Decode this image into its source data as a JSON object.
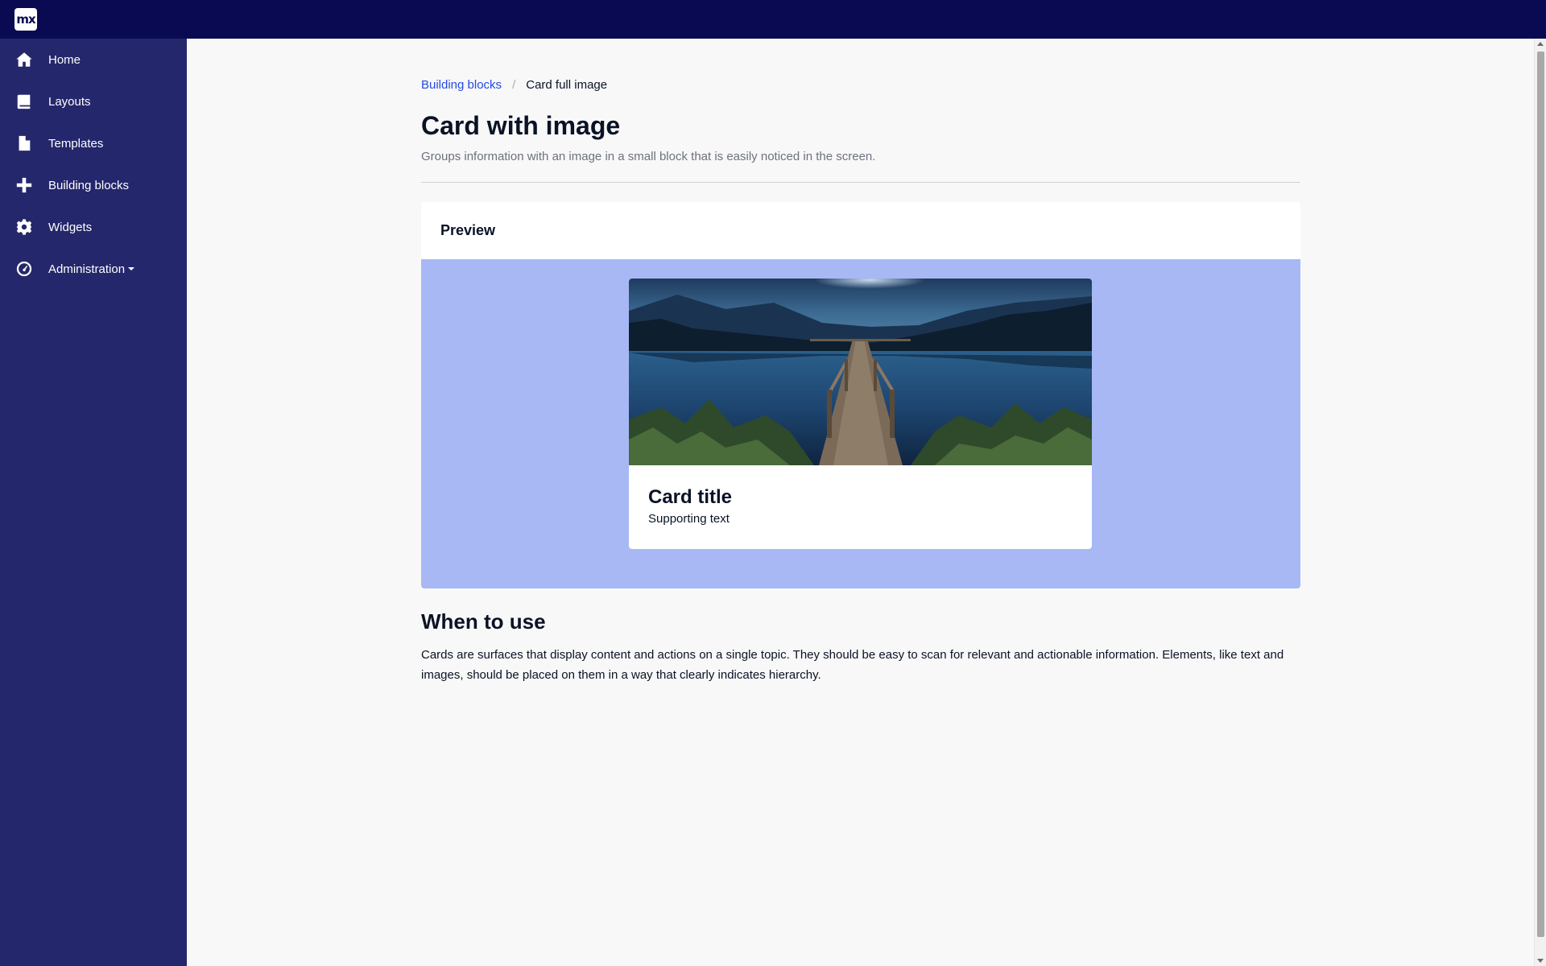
{
  "app": {
    "logo_text": "mx"
  },
  "sidebar": {
    "items": [
      {
        "label": "Home",
        "icon": "home-icon"
      },
      {
        "label": "Layouts",
        "icon": "book-icon"
      },
      {
        "label": "Templates",
        "icon": "file-icon"
      },
      {
        "label": "Building blocks",
        "icon": "plus-icon"
      },
      {
        "label": "Widgets",
        "icon": "gear-icon"
      },
      {
        "label": "Administration",
        "icon": "dashboard-icon",
        "has_dropdown": true
      }
    ]
  },
  "breadcrumb": {
    "parent": "Building blocks",
    "current": "Card full image"
  },
  "page": {
    "title": "Card with image",
    "subtitle": "Groups information with an image in a small block that is easily noticed in the screen."
  },
  "preview": {
    "heading": "Preview",
    "card": {
      "image": "lake-pier-night-image",
      "title": "Card title",
      "text": "Supporting text"
    }
  },
  "when_to_use": {
    "heading": "When to use",
    "text": "Cards are surfaces that display content and actions on a single topic. They should be easy to scan for relevant and actionable information. Elements, like text and images, should be placed on them in a way that clearly indicates hierarchy."
  },
  "colors": {
    "topbar": "#0a0a52",
    "sidebar": "#24276b",
    "link": "#264ae5",
    "preview_background": "#a8b8f5",
    "page_background": "#f8f8f8"
  }
}
